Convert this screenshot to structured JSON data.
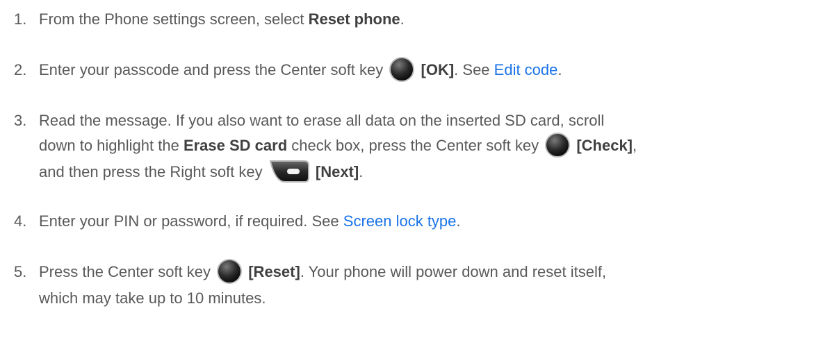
{
  "steps": [
    {
      "num": "1.",
      "t1": "From the Phone settings screen, select ",
      "b1": "Reset phone",
      "t2": "."
    },
    {
      "num": "2.",
      "t1": "Enter your passcode and press the Center soft key ",
      "key1": "center-soft-key-icon",
      "b1": "[OK]",
      "t2": ". See ",
      "link": "Edit code",
      "t3": "."
    },
    {
      "num": "3.",
      "t1": "Read the message. If you also want to erase all data on the inserted SD card, scroll",
      "t2": "down to highlight the ",
      "b1": "Erase SD card",
      "t3": " check box, press the Center soft key ",
      "key1": "center-soft-key-icon",
      "b2": "[Check]",
      "t4": ",",
      "t5": "and then press the Right soft key ",
      "key2": "right-soft-key-icon",
      "b3": "[Next]",
      "t6": "."
    },
    {
      "num": "4.",
      "t1": "Enter your PIN or password, if required. See ",
      "link": "Screen lock type",
      "t2": "."
    },
    {
      "num": "5.",
      "t1": "Press the Center soft key ",
      "key1": "center-soft-key-icon",
      "b1": "[Reset]",
      "t2": ". Your phone will power down and reset itself,",
      "t3": "which may take up to 10 minutes."
    }
  ]
}
